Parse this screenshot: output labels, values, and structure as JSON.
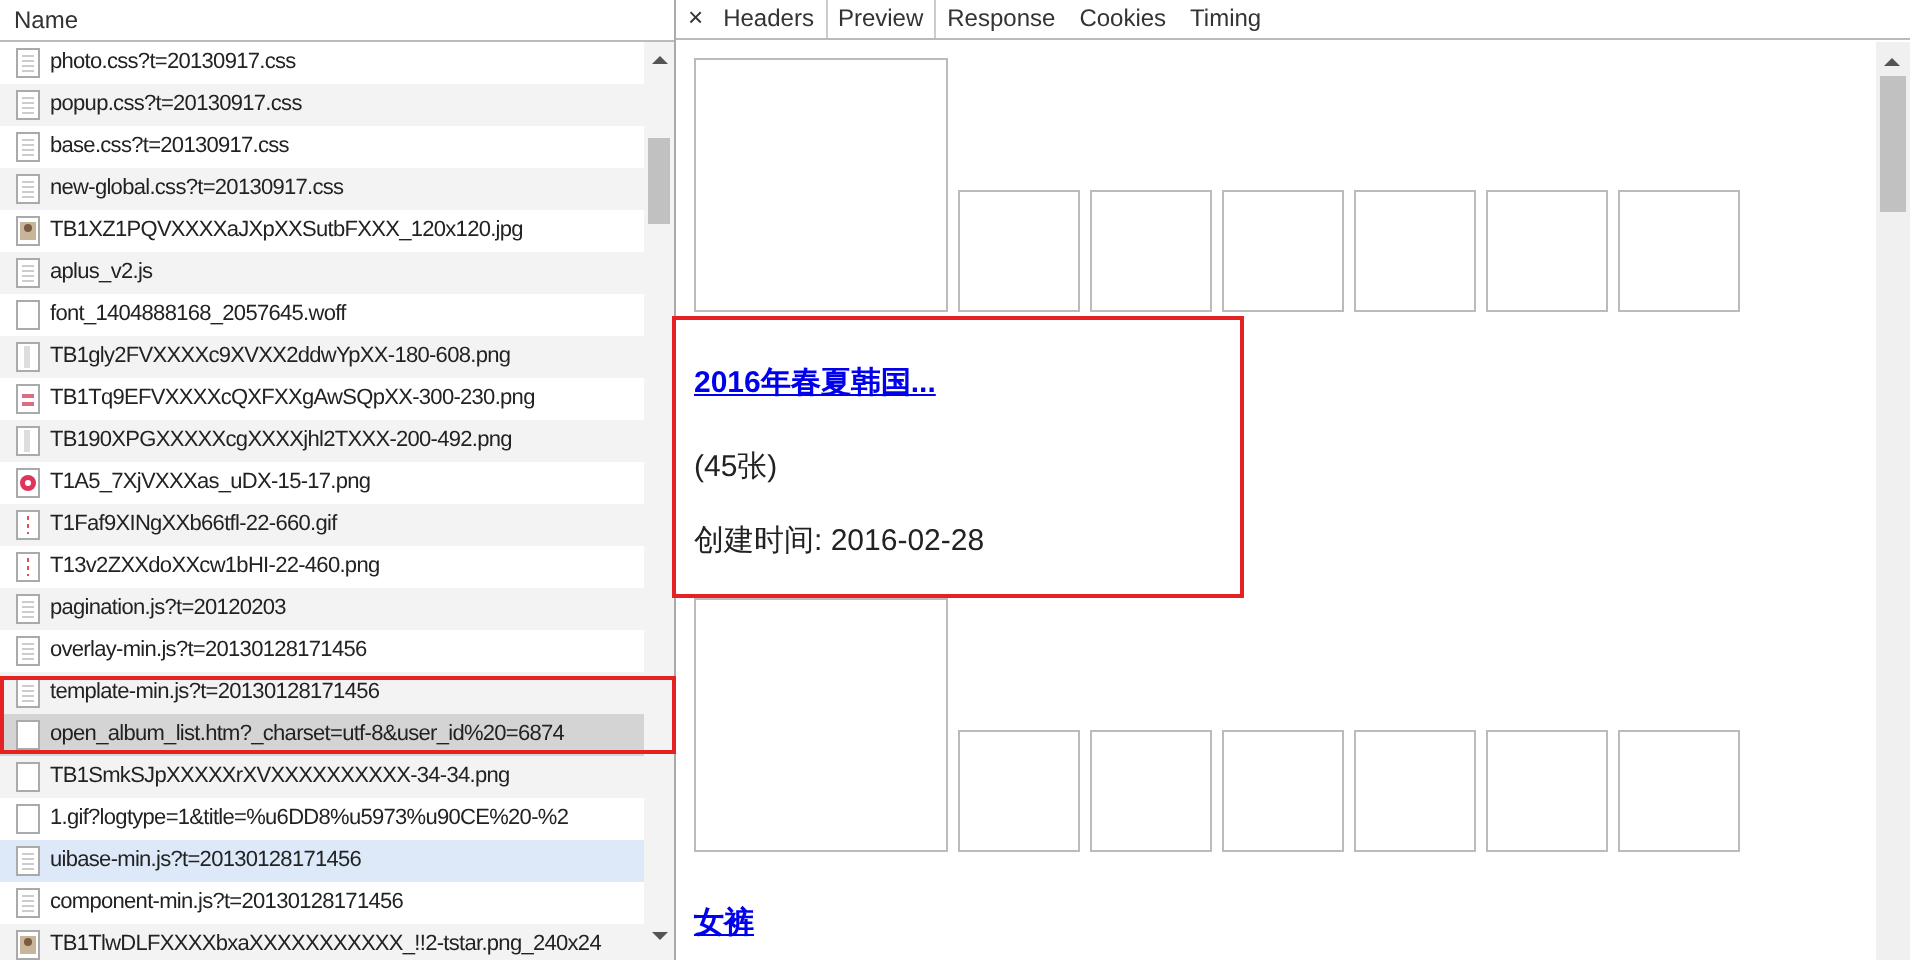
{
  "request_list": {
    "header": "Name",
    "rows": [
      {
        "name": "photo.css?t=20130917.css",
        "kind": "doc",
        "selected": false,
        "hovered": false
      },
      {
        "name": "popup.css?t=20130917.css",
        "kind": "doc",
        "selected": false,
        "hovered": false
      },
      {
        "name": "base.css?t=20130917.css",
        "kind": "doc",
        "selected": false,
        "hovered": false
      },
      {
        "name": "new-global.css?t=20130917.css",
        "kind": "doc",
        "selected": false,
        "hovered": false
      },
      {
        "name": "TB1XZ1PQVXXXXaJXpXXSutbFXXX_120x120.jpg",
        "kind": "photo",
        "selected": false,
        "hovered": false
      },
      {
        "name": "aplus_v2.js",
        "kind": "doc",
        "selected": false,
        "hovered": false
      },
      {
        "name": "font_1404888168_2057645.woff",
        "kind": "blank",
        "selected": false,
        "hovered": false
      },
      {
        "name": "TB1gly2FVXXXXc9XVXX2ddwYpXX-180-608.png",
        "kind": "strip",
        "selected": false,
        "hovered": false
      },
      {
        "name": "TB1Tq9EFVXXXXcQXFXXgAwSQpXX-300-230.png",
        "kind": "sprite",
        "selected": false,
        "hovered": false
      },
      {
        "name": "TB190XPGXXXXXcgXXXXjhl2TXXX-200-492.png",
        "kind": "strip",
        "selected": false,
        "hovered": false
      },
      {
        "name": "T1A5_7XjVXXXas_uDX-15-17.png",
        "kind": "badge",
        "selected": false,
        "hovered": false
      },
      {
        "name": "T1Faf9XINgXXb66tfl-22-660.gif",
        "kind": "dotted",
        "selected": false,
        "hovered": false
      },
      {
        "name": "T13v2ZXXdoXXcw1bHI-22-460.png",
        "kind": "dotted",
        "selected": false,
        "hovered": false
      },
      {
        "name": "pagination.js?t=20120203",
        "kind": "doc",
        "selected": false,
        "hovered": false
      },
      {
        "name": "overlay-min.js?t=20130128171456",
        "kind": "doc",
        "selected": false,
        "hovered": false
      },
      {
        "name": "template-min.js?t=20130128171456",
        "kind": "doc",
        "selected": false,
        "hovered": false
      },
      {
        "name": "open_album_list.htm?_charset=utf-8&user_id%20=6874",
        "kind": "blank",
        "selected": true,
        "hovered": false
      },
      {
        "name": "TB1SmkSJpXXXXXrXVXXXXXXXXXX-34-34.png",
        "kind": "blank",
        "selected": false,
        "hovered": false
      },
      {
        "name": "1.gif?logtype=1&title=%u6DD8%u5973%u90CE%20-%2",
        "kind": "blank",
        "selected": false,
        "hovered": false
      },
      {
        "name": "uibase-min.js?t=20130128171456",
        "kind": "doc",
        "selected": false,
        "hovered": true
      },
      {
        "name": "component-min.js?t=20130128171456",
        "kind": "doc",
        "selected": false,
        "hovered": false
      },
      {
        "name": "TB1TlwDLFXXXXbxaXXXXXXXXXXX_!!2-tstar.png_240x24",
        "kind": "photo",
        "selected": false,
        "hovered": false
      }
    ]
  },
  "detail": {
    "close": "×",
    "tabs": [
      {
        "label": "Headers",
        "selected": false
      },
      {
        "label": "Preview",
        "selected": true
      },
      {
        "label": "Response",
        "selected": false
      },
      {
        "label": "Cookies",
        "selected": false
      },
      {
        "label": "Timing",
        "selected": false
      }
    ],
    "albums": [
      {
        "title": "2016年春夏韩国...",
        "count": "(45张)",
        "created": "创建时间: 2016-02-28"
      },
      {
        "title": "女裤"
      }
    ]
  }
}
